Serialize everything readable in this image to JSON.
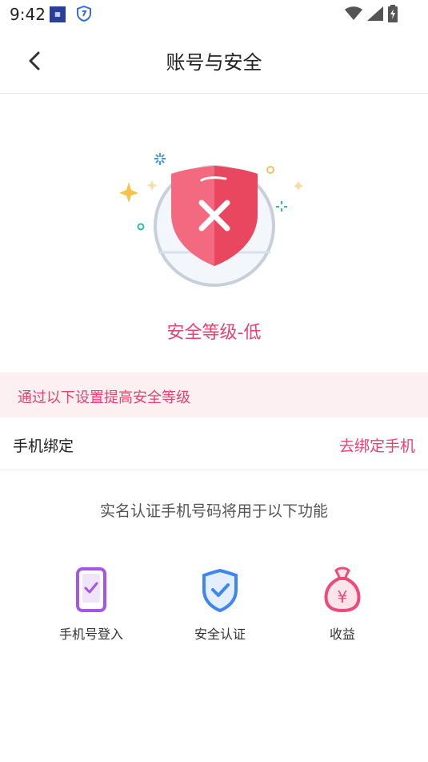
{
  "status_bar": {
    "time": "9:42",
    "icons": [
      "app-notification-icon",
      "shield-app-icon",
      "wifi-icon",
      "signal-icon",
      "battery-charging-icon"
    ]
  },
  "header": {
    "title": "账号与安全",
    "back_icon": "chevron-left-icon"
  },
  "hero": {
    "security_level": "安全等级-低",
    "shield_icon": "shield-x-icon",
    "colors": {
      "shield": "#ef5a72",
      "accent": "#e8416f"
    }
  },
  "tip": {
    "text": "通过以下设置提高安全等级"
  },
  "phone_binding": {
    "label": "手机绑定",
    "action": "去绑定手机"
  },
  "features_intro": "实名认证手机号码将用于以下功能",
  "features": [
    {
      "label": "手机号登入",
      "icon": "phone-check-icon",
      "color": "#a555e8"
    },
    {
      "label": "安全认证",
      "icon": "shield-check-icon",
      "color": "#3e86f0"
    },
    {
      "label": "收益",
      "icon": "money-bag-icon",
      "color": "#ee4a78"
    }
  ]
}
